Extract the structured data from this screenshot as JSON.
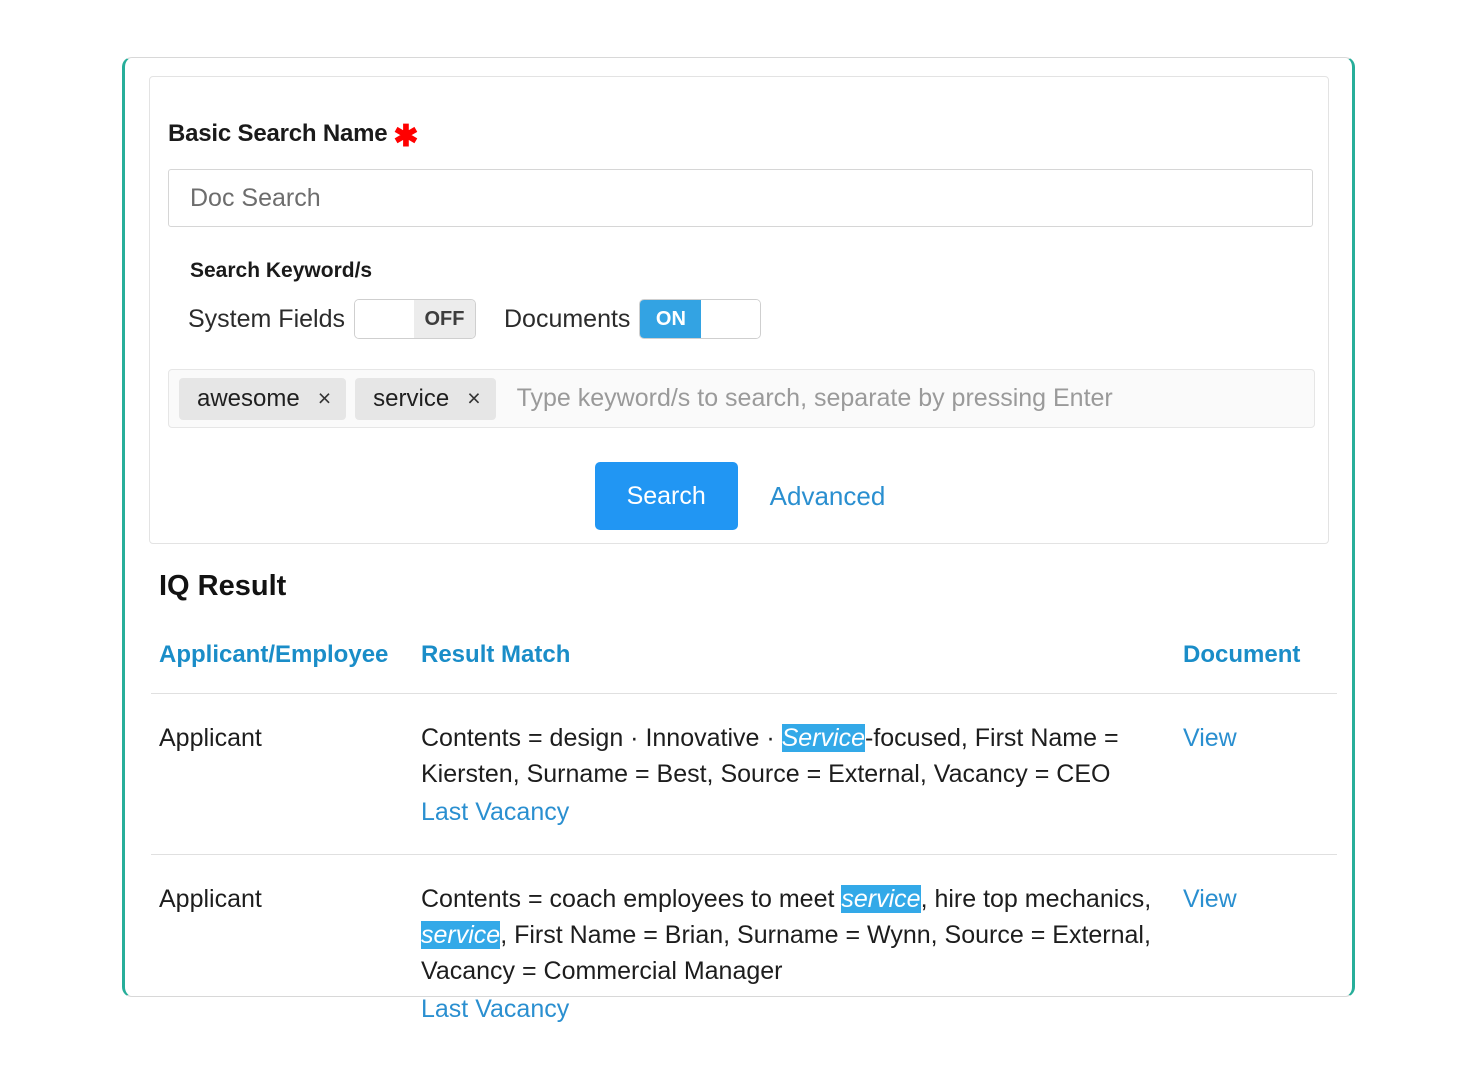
{
  "form": {
    "name_label": "Basic Search Name",
    "required_marker": "✱",
    "name_value": "Doc Search",
    "name_placeholder": "Doc Search",
    "keywords_title": "Search Keyword/s",
    "toggles": [
      {
        "label": "System Fields",
        "state": "OFF",
        "on": false
      },
      {
        "label": "Documents",
        "state": "ON",
        "on": true
      }
    ],
    "tags": [
      {
        "text": "awesome",
        "remove": "×"
      },
      {
        "text": "service",
        "remove": "×"
      }
    ],
    "tag_placeholder": "Type keyword/s to search, separate by pressing Enter",
    "search_label": "Search",
    "advanced_label": "Advanced"
  },
  "results": {
    "title": "IQ Result",
    "columns": {
      "applicant": "Applicant/Employee",
      "match": "Result Match",
      "document": "Document"
    },
    "rows": [
      {
        "applicant": "Applicant",
        "match_parts": [
          {
            "t": "Contents = design · Innovative · ",
            "hl": false
          },
          {
            "t": "Service",
            "hl": true
          },
          {
            "t": "-focused, First Name = Kiersten, Surname = Best, Source = External, Vacancy = CEO",
            "hl": false
          }
        ],
        "link": "Last Vacancy",
        "document": "View"
      },
      {
        "applicant": "Applicant",
        "match_parts": [
          {
            "t": "Contents = coach employees to meet ",
            "hl": false
          },
          {
            "t": "service",
            "hl": true
          },
          {
            "t": ", hire top mechanics, ",
            "hl": false
          },
          {
            "t": "service",
            "hl": true
          },
          {
            "t": ", First Name = Brian, Surname = Wynn, Source = External, Vacancy = Commercial Manager",
            "hl": false
          }
        ],
        "link": "Last Vacancy",
        "document": "View"
      }
    ]
  },
  "colors": {
    "accent_teal": "#27ae9a",
    "link_blue": "#2a8fd0",
    "header_blue": "#1a8dc8",
    "button_blue": "#2196f3",
    "highlight_blue": "#33a9e8",
    "required_red": "#ff0000"
  }
}
